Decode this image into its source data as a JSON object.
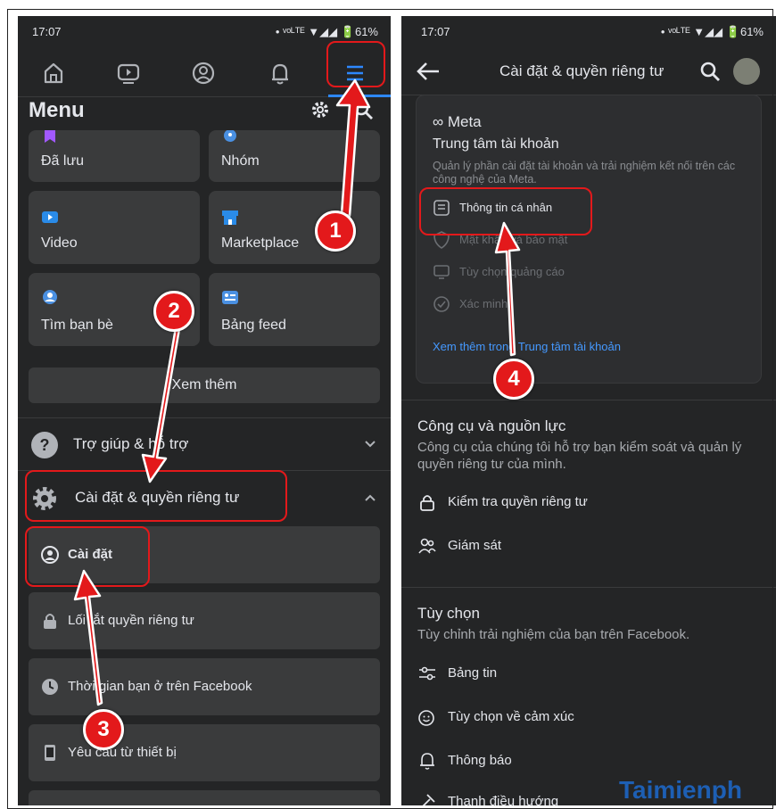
{
  "left": {
    "status": {
      "time": "17:07",
      "icons": "• ᵛᵒᴸᵀᴱ ▼◢◢ 🔋61%"
    },
    "menu_title": "Menu",
    "tiles": [
      {
        "label": "Đã lưu",
        "icon": "bookmark-icon",
        "color": "#a259ff"
      },
      {
        "label": "Nhóm",
        "icon": "groups-icon",
        "color": "#4a90e2"
      },
      {
        "label": "Video",
        "icon": "video-icon",
        "color": "#2a8be8"
      },
      {
        "label": "Marketplace",
        "icon": "shop-icon",
        "color": "#2a8be8"
      },
      {
        "label": "Tìm bạn bè",
        "icon": "friends-icon",
        "color": "#4a90e2"
      },
      {
        "label": "Bảng feed",
        "icon": "feed-icon",
        "color": "#4a90e2"
      }
    ],
    "see_more": "Xem thêm",
    "help": "Trợ giúp & hỗ trợ",
    "settings_privacy": "Cài đặt & quyền riêng tư",
    "sub_items": [
      "Cài đặt",
      "Lối tắt quyền riêng tư",
      "Thời gian bạn ở trên Facebook",
      "Yêu cầu từ thiết bị"
    ]
  },
  "right": {
    "status": {
      "time": "17:07",
      "icons": "• ᵛᵒᴸᵀᴱ ▼◢◢ 🔋61%"
    },
    "title": "Cài đặt & quyền riêng tư",
    "card": {
      "logo": "∞ Meta",
      "title": "Trung tâm tài khoản",
      "desc": "Quản lý phần cài đặt tài khoản và trải nghiệm kết nối trên các công nghệ của Meta.",
      "items": [
        "Thông tin cá nhân",
        "Mật khẩu và bảo mật",
        "Tùy chọn quảng cáo",
        "Xác minh"
      ],
      "link": "Xem thêm trong Trung tâm tài khoản"
    },
    "tools": {
      "title": "Công cụ và nguồn lực",
      "desc": "Công cụ của chúng tôi hỗ trợ bạn kiểm soát và quản lý quyền riêng tư của mình.",
      "items": [
        "Kiểm tra quyền riêng tư",
        "Giám sát"
      ]
    },
    "prefs": {
      "title": "Tùy chọn",
      "desc": "Tùy chỉnh trải nghiệm của bạn trên Facebook.",
      "items": [
        "Bảng tin",
        "Tùy chọn về cảm xúc",
        "Thông báo",
        "Thanh điều hướng"
      ]
    }
  },
  "badges": [
    "1",
    "2",
    "3",
    "4"
  ],
  "watermark": "Taimienph",
  "colors": {
    "bg": "#242526",
    "surface": "#3a3b3c",
    "accent": "#2d88ff",
    "highlight": "#e3191b",
    "link": "#4599ff"
  }
}
